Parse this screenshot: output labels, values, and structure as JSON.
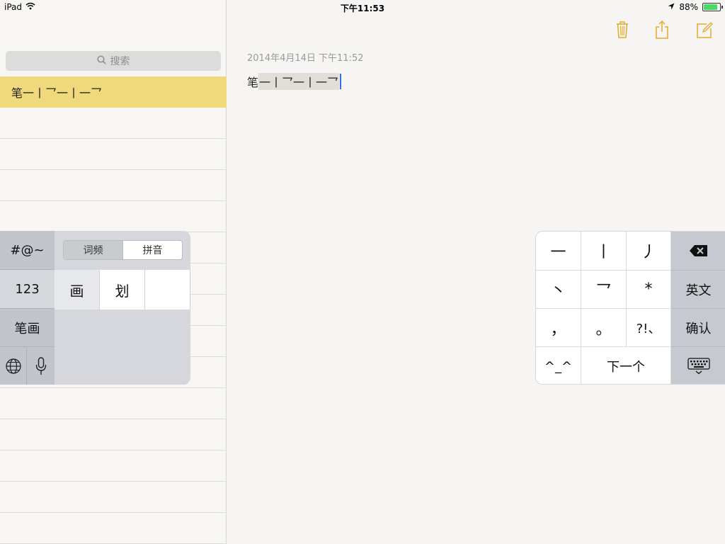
{
  "status_bar": {
    "device": "iPad",
    "time": "下午11:53",
    "battery": "88%",
    "battery_level": 0.88
  },
  "sidebar": {
    "search_placeholder": "搜索",
    "notes": [
      {
        "title": "笔一丨乛一丨一乛",
        "selected": true
      }
    ]
  },
  "toolbar": {
    "icons": [
      "trash-icon",
      "share-icon",
      "compose-icon"
    ],
    "accent_color": "#e6a928"
  },
  "note": {
    "date": "2014年4月14日 下午11:52",
    "committed_text": "笔",
    "marked_text": "一丨乛一丨一乛"
  },
  "keyboard_left": {
    "symbols": "#@~",
    "numbers": "123",
    "mode": "笔画",
    "segments": [
      "词频",
      "拼音"
    ],
    "candidates": [
      "画",
      "划",
      ""
    ]
  },
  "keyboard_right": {
    "keys": [
      "一",
      "丨",
      "丿",
      "丶",
      "乛",
      "*",
      "，",
      "。",
      "?!、",
      "^_^",
      "下一个"
    ],
    "english": "英文",
    "confirm": "确认"
  }
}
